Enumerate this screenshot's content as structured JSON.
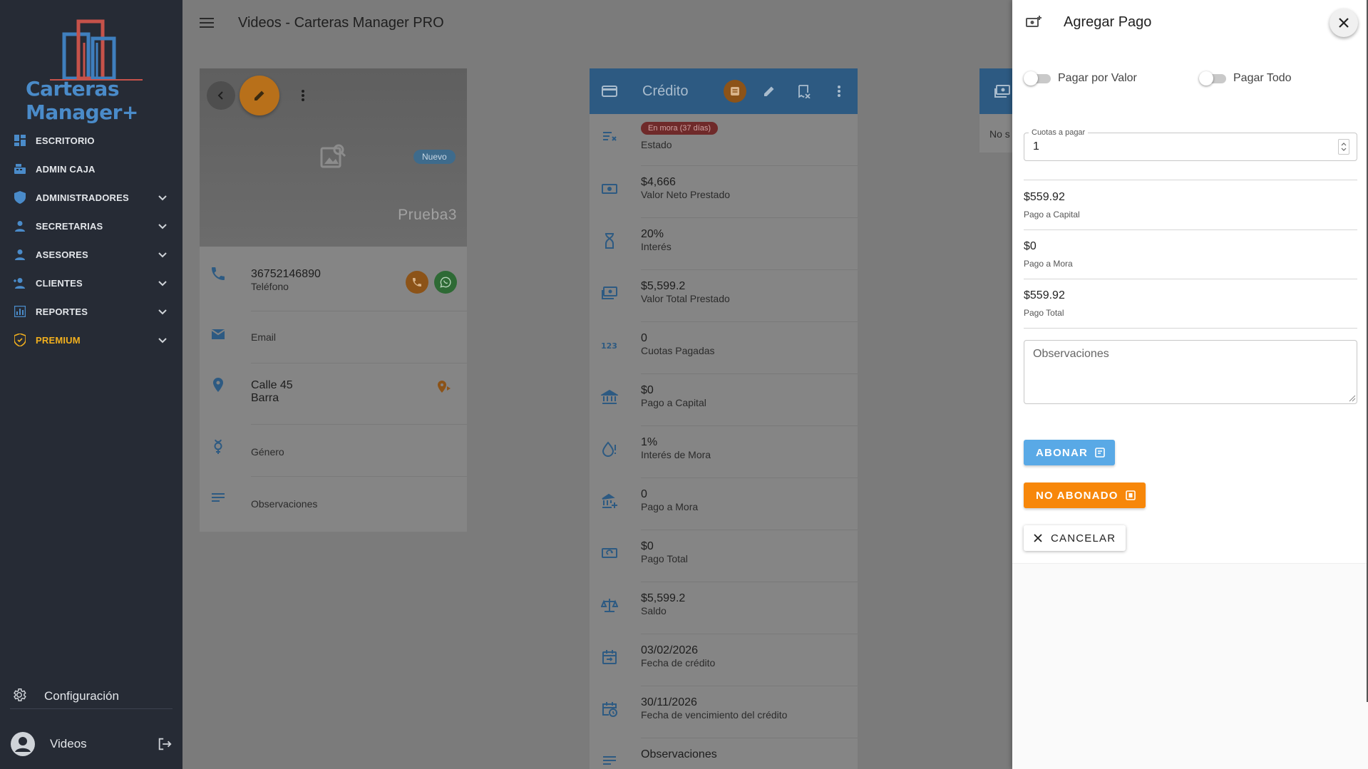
{
  "app": {
    "logo_text": "Carteras Manager+",
    "page_title": "Videos - Carteras Manager PRO"
  },
  "sidebar": {
    "items": [
      {
        "label": "ESCRITORIO",
        "icon": "dashboard-icon",
        "expandable": false
      },
      {
        "label": "ADMIN CAJA",
        "icon": "cash-register-icon",
        "expandable": false
      },
      {
        "label": "ADMINISTRADORES",
        "icon": "shield-icon",
        "expandable": true
      },
      {
        "label": "SECRETARIAS",
        "icon": "person-icon",
        "expandable": true
      },
      {
        "label": "ASESORES",
        "icon": "person-icon",
        "expandable": true
      },
      {
        "label": "CLIENTES",
        "icon": "person-add-icon",
        "expandable": true
      },
      {
        "label": "REPORTES",
        "icon": "bar-chart-icon",
        "expandable": true
      },
      {
        "label": "PREMIUM",
        "icon": "premium-badge-icon",
        "expandable": true
      }
    ],
    "config_label": "Configuración",
    "user_name": "Videos"
  },
  "client": {
    "badge": "Nuevo",
    "name": "Prueba3",
    "phone": "36752146890",
    "phone_label": "Teléfono",
    "email_label": "Email",
    "address_line1": "Calle 45",
    "address_line2": "Barra",
    "gender_label": "Género",
    "observations_label": "Observaciones"
  },
  "credit": {
    "title": "Crédito",
    "rows": [
      {
        "value": "En mora (37 días)",
        "label": "Estado",
        "icon": "status-icon"
      },
      {
        "value": "$4,666",
        "label": "Valor Neto Prestado",
        "icon": "money-icon"
      },
      {
        "value": "20%",
        "label": "Interés",
        "icon": "hourglass-icon"
      },
      {
        "value": "$5,599.2",
        "label": "Valor Total Prestado",
        "icon": "cash-icon"
      },
      {
        "value": "0",
        "label": "Cuotas Pagadas",
        "icon": "numbers-icon"
      },
      {
        "value": "$0",
        "label": "Pago a Capital",
        "icon": "bank-icon"
      },
      {
        "value": "1%",
        "label": "Interés de Mora",
        "icon": "alert-drop-icon"
      },
      {
        "value": "0",
        "label": "Pago a Mora",
        "icon": "bank-add-icon"
      },
      {
        "value": "$0",
        "label": "Pago Total",
        "icon": "cash-sync-icon"
      },
      {
        "value": "$5,599.2",
        "label": "Saldo",
        "icon": "scale-icon"
      },
      {
        "value": "03/02/2026",
        "label": "Fecha de crédito",
        "icon": "calendar-icon"
      },
      {
        "value": "30/11/2026",
        "label": "Fecha de vencimiento del crédito",
        "icon": "calendar-clock-icon"
      },
      {
        "value": "Observaciones",
        "label": "",
        "icon": "notes-icon"
      }
    ]
  },
  "right_card": {
    "text": "No s"
  },
  "drawer": {
    "title": "Agregar Pago",
    "toggle_by_value": "Pagar por Valor",
    "toggle_all": "Pagar Todo",
    "quotas_label": "Cuotas a pagar",
    "quotas_value": "1",
    "capital_value": "$559.92",
    "capital_label": "Pago a Capital",
    "mora_value": "$0",
    "mora_label": "Pago a Mora",
    "total_value": "$559.92",
    "total_label": "Pago Total",
    "observations_placeholder": "Observaciones",
    "btn_abonar": "ABONAR",
    "btn_no_abonado": "NO ABONADO",
    "btn_cancel": "CANCELAR"
  },
  "colors": {
    "sidebar_bg": "#262b35",
    "premium": "#f2b01e",
    "primary": "#59a9e6",
    "warning": "#f7870a",
    "danger_badge": "#6f2a2a"
  }
}
